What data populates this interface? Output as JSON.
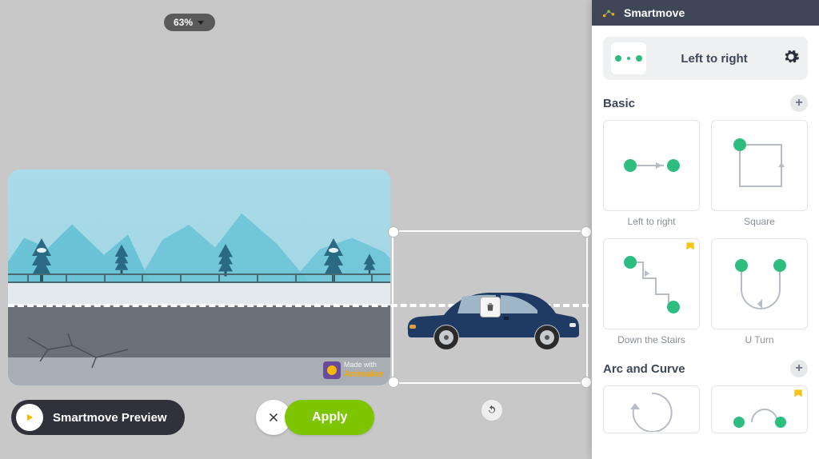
{
  "zoom": {
    "value": "63%"
  },
  "watermark": {
    "line1": "Made with",
    "brand": "Animaker"
  },
  "controls": {
    "preview_label": "Smartmove Preview",
    "apply_label": "Apply"
  },
  "panel": {
    "title": "Smartmove",
    "current_move": "Left to right",
    "sections": [
      {
        "title": "Basic",
        "items": [
          {
            "label": "Left to right",
            "thumb": "ltr",
            "starred": false
          },
          {
            "label": "Square",
            "thumb": "square",
            "starred": false
          },
          {
            "label": "Down the Stairs",
            "thumb": "stairs",
            "starred": true
          },
          {
            "label": "U Turn",
            "thumb": "uturn",
            "starred": false
          }
        ]
      },
      {
        "title": "Arc and Curve",
        "items": [
          {
            "label": "",
            "thumb": "circle",
            "starred": false
          },
          {
            "label": "",
            "thumb": "drop",
            "starred": true
          }
        ]
      }
    ]
  }
}
